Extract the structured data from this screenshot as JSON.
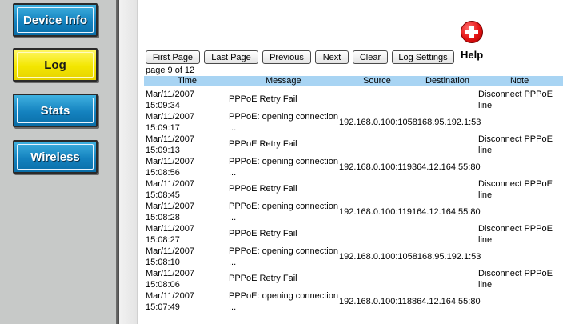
{
  "sidebar": {
    "items": [
      {
        "label": "Device Info",
        "active": false
      },
      {
        "label": "Log",
        "active": true
      },
      {
        "label": "Stats",
        "active": false
      },
      {
        "label": "Wireless",
        "active": false
      }
    ]
  },
  "toolbar": {
    "first_page": "First Page",
    "last_page": "Last Page",
    "previous": "Previous",
    "next": "Next",
    "clear": "Clear",
    "log_settings": "Log Settings",
    "help": "Help"
  },
  "page_info": "page 9 of 12",
  "table": {
    "headers": {
      "time": "Time",
      "message": "Message",
      "source": "Source",
      "destination": "Destination",
      "note": "Note"
    },
    "rows": [
      {
        "date": "Mar/11/2007",
        "time": "15:09:34",
        "msg1": "PPPoE Retry Fail",
        "msg2": "",
        "source": "",
        "destination": "",
        "note1": "Disconnect PPPoE",
        "note2": "line"
      },
      {
        "date": "Mar/11/2007",
        "time": "15:09:17",
        "msg1": "PPPoE: opening connection",
        "msg2": "...",
        "source": "192.168.0.100:1058",
        "destination": "168.95.192.1:53",
        "note1": "",
        "note2": ""
      },
      {
        "date": "Mar/11/2007",
        "time": "15:09:13",
        "msg1": "PPPoE Retry Fail",
        "msg2": "",
        "source": "",
        "destination": "",
        "note1": "Disconnect PPPoE",
        "note2": "line"
      },
      {
        "date": "Mar/11/2007",
        "time": "15:08:56",
        "msg1": "PPPoE: opening connection",
        "msg2": "...",
        "source": "192.168.0.100:1193",
        "destination": "64.12.164.55:80",
        "note1": "",
        "note2": ""
      },
      {
        "date": "Mar/11/2007",
        "time": "15:08:45",
        "msg1": "PPPoE Retry Fail",
        "msg2": "",
        "source": "",
        "destination": "",
        "note1": "Disconnect PPPoE",
        "note2": "line"
      },
      {
        "date": "Mar/11/2007",
        "time": "15:08:28",
        "msg1": "PPPoE: opening connection",
        "msg2": "...",
        "source": "192.168.0.100:1191",
        "destination": "64.12.164.55:80",
        "note1": "",
        "note2": ""
      },
      {
        "date": "Mar/11/2007",
        "time": "15:08:27",
        "msg1": "PPPoE Retry Fail",
        "msg2": "",
        "source": "",
        "destination": "",
        "note1": "Disconnect PPPoE",
        "note2": "line"
      },
      {
        "date": "Mar/11/2007",
        "time": "15:08:10",
        "msg1": "PPPoE: opening connection",
        "msg2": "...",
        "source": "192.168.0.100:1058",
        "destination": "168.95.192.1:53",
        "note1": "",
        "note2": ""
      },
      {
        "date": "Mar/11/2007",
        "time": "15:08:06",
        "msg1": "PPPoE Retry Fail",
        "msg2": "",
        "source": "",
        "destination": "",
        "note1": "Disconnect PPPoE",
        "note2": "line"
      },
      {
        "date": "Mar/11/2007",
        "time": "15:07:49",
        "msg1": "PPPoE: opening connection",
        "msg2": "...",
        "source": "192.168.0.100:1188",
        "destination": "64.12.164.55:80",
        "note1": "",
        "note2": ""
      }
    ]
  },
  "colors": {
    "nav_blue": "#1482bf",
    "nav_active_yellow": "#f3e600",
    "table_header": "#a8d4f3",
    "help_red": "#e41212"
  },
  "icons": {
    "help": "help-plus-icon"
  }
}
